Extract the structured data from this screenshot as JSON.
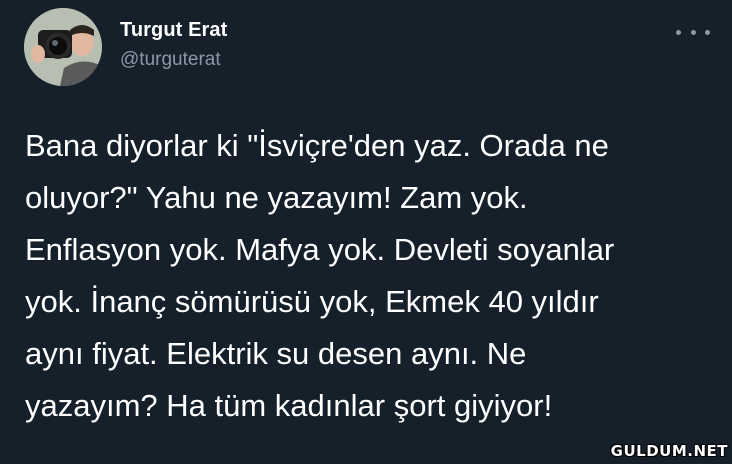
{
  "author": {
    "name": "Turgut Erat",
    "handle": "@turguterat",
    "avatar_icon": "photographer-avatar"
  },
  "more_options_icon": "ellipsis-icon",
  "tweet": {
    "lines": [
      "Bana diyorlar ki \"İsviçre'den yaz. Orada ne",
      "oluyor?\" Yahu ne yazayım! Zam yok.",
      "Enflasyon yok. Mafya yok. Devleti soyanlar",
      "yok. İnanç sömürüsü yok, Ekmek 40 yıldır",
      "aynı fiyat. Elektrik su desen aynı. Ne",
      "yazayım? Ha tüm kadınlar şort giyiyor!"
    ]
  },
  "watermark": "GULDUM.NET",
  "colors": {
    "background": "#15202b",
    "text": "#ffffff",
    "secondary": "#8b98a5"
  }
}
